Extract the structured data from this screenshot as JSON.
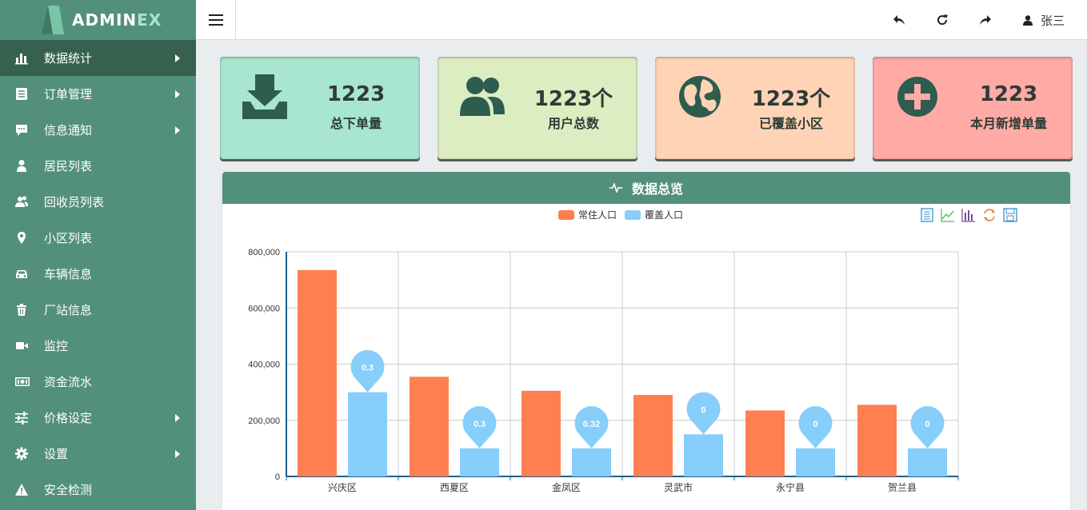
{
  "app": {
    "logo_text_1": "ADMIN",
    "logo_text_2": "EX"
  },
  "header": {
    "user_name": "张三"
  },
  "sidebar": {
    "items": [
      {
        "label": "数据统计",
        "icon": "bar-chart-icon",
        "has_arrow": true,
        "active": true
      },
      {
        "label": "订单管理",
        "icon": "list-alt-icon",
        "has_arrow": true
      },
      {
        "label": "信息通知",
        "icon": "comment-icon",
        "has_arrow": true
      },
      {
        "label": "居民列表",
        "icon": "user-icon",
        "has_arrow": false
      },
      {
        "label": "回收员列表",
        "icon": "users-icon",
        "has_arrow": false
      },
      {
        "label": "小区列表",
        "icon": "map-marker-icon",
        "has_arrow": false
      },
      {
        "label": "车辆信息",
        "icon": "car-icon",
        "has_arrow": false
      },
      {
        "label": "厂站信息",
        "icon": "trash-icon",
        "has_arrow": false
      },
      {
        "label": "监控",
        "icon": "video-camera-icon",
        "has_arrow": false
      },
      {
        "label": "资金流水",
        "icon": "money-icon",
        "has_arrow": false
      },
      {
        "label": "价格设定",
        "icon": "sliders-icon",
        "has_arrow": true
      },
      {
        "label": "设置",
        "icon": "gear-icon",
        "has_arrow": true
      },
      {
        "label": "安全检测",
        "icon": "warning-icon",
        "has_arrow": false
      }
    ]
  },
  "cards": [
    {
      "value": "1223",
      "label": "总下单量",
      "icon": "download-tray-icon",
      "color": "#a8e6cf"
    },
    {
      "value": "1223个",
      "label": "用户总数",
      "icon": "users-icon",
      "color": "#dcedc1"
    },
    {
      "value": "1223个",
      "label": "已覆盖小区",
      "icon": "globe-icon",
      "color": "#ffd3b6"
    },
    {
      "value": "1223",
      "label": "本月新增单量",
      "icon": "plus-circle-icon",
      "color": "#ffaaa5"
    }
  ],
  "panel": {
    "title": "数据总览"
  },
  "chart_data": {
    "type": "bar",
    "categories": [
      "兴庆区",
      "西夏区",
      "金凤区",
      "灵武市",
      "永宁县",
      "贺兰县"
    ],
    "series": [
      {
        "name": "常住人口",
        "color": "#ff7f50",
        "values": [
          735000,
          355000,
          305000,
          290000,
          235000,
          255000
        ]
      },
      {
        "name": "覆盖人口",
        "color": "#87cefa",
        "values": [
          300000,
          100000,
          100000,
          150000,
          100000,
          100000
        ],
        "markers": [
          "0.3",
          "0.3",
          "0.32",
          "0",
          "0",
          "0"
        ]
      }
    ],
    "ylim": [
      0,
      800000
    ],
    "yticks": [
      "0",
      "200,000",
      "400,000",
      "600,000",
      "800,000"
    ],
    "grid": true,
    "legend_position": "top-center"
  }
}
